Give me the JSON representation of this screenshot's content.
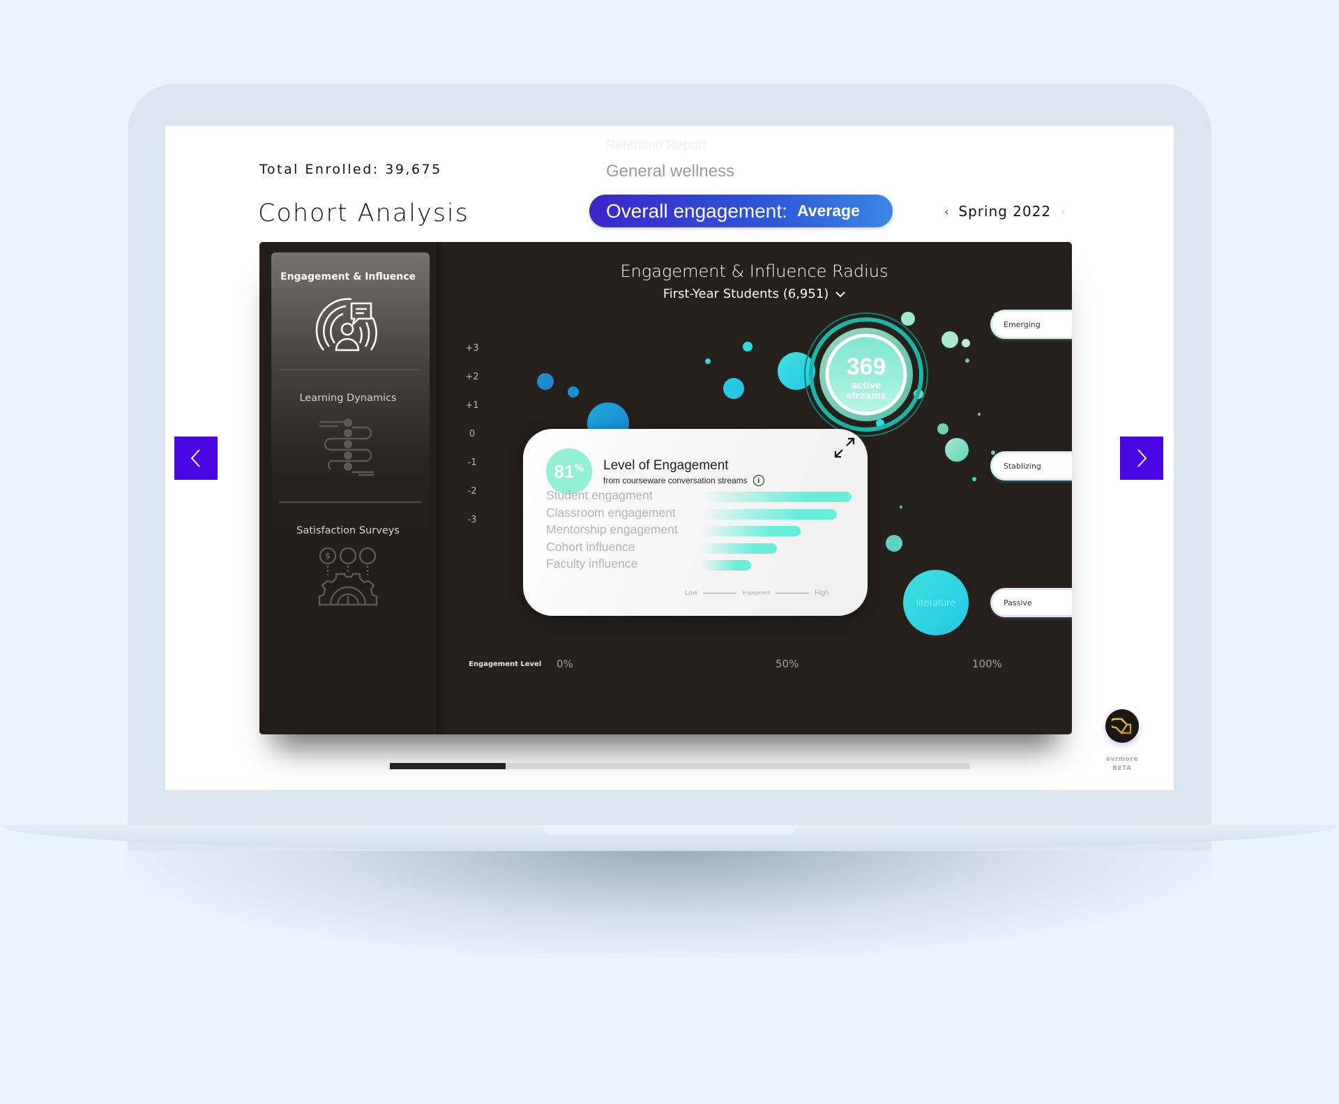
{
  "header": {
    "total_enrolled": "Total Enrolled: 39,675",
    "title": "Cohort Analysis",
    "report_options": [
      "Retention Report",
      "General wellness"
    ],
    "engagement_pill": {
      "label": "Overall engagement:",
      "value": "Average"
    },
    "season": {
      "prev": "‹",
      "label": "Spring 2022",
      "next": "›"
    }
  },
  "sidebar": {
    "items": [
      {
        "label": "Engagement & Influence",
        "icon": "engagement-radius-icon",
        "active": true
      },
      {
        "label": "Learning Dynamics",
        "icon": "learning-path-icon",
        "active": false
      },
      {
        "label": "Satisfaction Surveys",
        "icon": "satisfaction-gauge-icon",
        "active": false
      }
    ]
  },
  "chart": {
    "title": "Engagement & Influence Radius",
    "subtitle": "First-Year Students (6,951)",
    "y_ticks": [
      "+3",
      "+2",
      "+1",
      "0",
      "-1",
      "-2",
      "-3"
    ],
    "x_axis_label": "Engagement Level",
    "x_ticks": [
      "0%",
      "50%",
      "100%"
    ],
    "center_stat": {
      "value": "369",
      "label_line1": "active",
      "label_line2": "streams"
    },
    "bubble_label": "literature",
    "stage_tags": [
      "Emerging",
      "Stablizing",
      "Passive"
    ]
  },
  "engagement_card": {
    "percent": "81",
    "percent_symbol": "%",
    "title": "Level of Engagement",
    "subtitle": "from courseware conversation streams",
    "metrics": [
      {
        "label": "Student engagment",
        "value": 1.0
      },
      {
        "label": "Classroom engagement",
        "value": 0.9
      },
      {
        "label": "Mentorship engagement",
        "value": 0.66
      },
      {
        "label": "Cohort influence",
        "value": 0.5
      },
      {
        "label": "Faculty influence",
        "value": 0.33
      }
    ],
    "legend": {
      "low": "Low",
      "mid": "Engagement",
      "high": "High"
    }
  },
  "progress": {
    "fraction": 0.2
  },
  "brand": {
    "name": "evrmore",
    "tag": "BETA"
  },
  "colors": {
    "accent": "#4a06e0",
    "pill_start": "#3b25c9",
    "pill_end": "#3a86e4",
    "mint": "#93f0d7",
    "cyan": "#2fd9e6",
    "dashboard_bg": "#25201c"
  }
}
